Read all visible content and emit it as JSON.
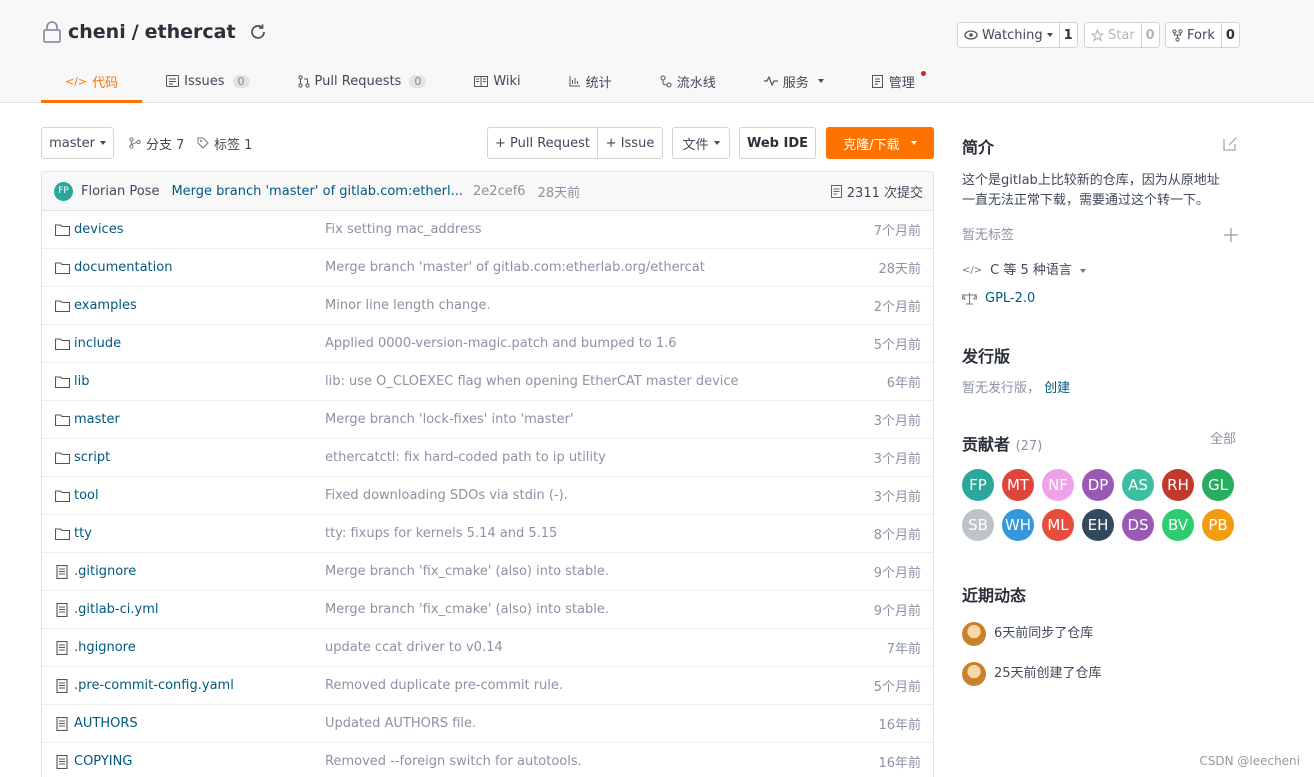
{
  "repo": {
    "owner": "cheni",
    "sep": "/",
    "name": "ethercat"
  },
  "actions": {
    "watch": {
      "label": "Watching",
      "count": "1"
    },
    "star": {
      "label": "Star",
      "count": "0"
    },
    "fork": {
      "label": "Fork",
      "count": "0"
    }
  },
  "tabs": [
    {
      "label": "代码",
      "icon": "code-icon"
    },
    {
      "label": "Issues",
      "badge": "0",
      "icon": "issues-icon"
    },
    {
      "label": "Pull Requests",
      "badge": "0",
      "icon": "pull-request-icon"
    },
    {
      "label": "Wiki",
      "icon": "wiki-icon"
    },
    {
      "label": "统计",
      "icon": "chart-icon"
    },
    {
      "label": "流水线",
      "icon": "pipeline-icon"
    },
    {
      "label": "服务",
      "icon": "pulse-icon"
    },
    {
      "label": "管理",
      "icon": "manage-icon"
    }
  ],
  "toolbar": {
    "branch": "master",
    "branches": "分支 7",
    "tags": "标签 1",
    "pull_request": "+ Pull Request",
    "issue": "+ Issue",
    "file": "文件",
    "web_ide": "Web IDE",
    "clone": "克隆/下载"
  },
  "commit": {
    "avatar": "FP",
    "author": "Florian Pose",
    "message": "Merge branch 'master' of gitlab.com:etherl...",
    "sha": "2e2cef6",
    "time": "28天前",
    "count": "2311 次提交"
  },
  "files": [
    {
      "type": "folder",
      "name": "devices",
      "msg": "Fix setting mac_address",
      "time": "7个月前"
    },
    {
      "type": "folder",
      "name": "documentation",
      "msg": "Merge branch 'master' of gitlab.com:etherlab.org/ethercat",
      "time": "28天前"
    },
    {
      "type": "folder",
      "name": "examples",
      "msg": "Minor line length change.",
      "time": "2个月前"
    },
    {
      "type": "folder",
      "name": "include",
      "msg": "Applied 0000-version-magic.patch and bumped to 1.6",
      "time": "5个月前"
    },
    {
      "type": "folder",
      "name": "lib",
      "msg": "lib: use O_CLOEXEC flag when opening EtherCAT master device",
      "time": "6年前"
    },
    {
      "type": "folder",
      "name": "master",
      "msg": "Merge branch 'lock-fixes' into 'master'",
      "time": "3个月前"
    },
    {
      "type": "folder",
      "name": "script",
      "msg": "ethercatctl: fix hard-coded path to ip utility",
      "time": "3个月前"
    },
    {
      "type": "folder",
      "name": "tool",
      "msg": "Fixed downloading SDOs via stdin (-).",
      "time": "3个月前"
    },
    {
      "type": "folder",
      "name": "tty",
      "msg": "tty: fixups for kernels 5.14 and 5.15",
      "time": "8个月前"
    },
    {
      "type": "file",
      "name": ".gitignore",
      "msg": "Merge branch 'fix_cmake' (also) into stable.",
      "time": "9个月前"
    },
    {
      "type": "file",
      "name": ".gitlab-ci.yml",
      "msg": "Merge branch 'fix_cmake' (also) into stable.",
      "time": "9个月前"
    },
    {
      "type": "file",
      "name": ".hgignore",
      "msg": "update ccat driver to v0.14",
      "time": "7年前"
    },
    {
      "type": "file",
      "name": ".pre-commit-config.yaml",
      "msg": "Removed duplicate pre-commit rule.",
      "time": "5个月前"
    },
    {
      "type": "file",
      "name": "AUTHORS",
      "msg": "Updated AUTHORS file.",
      "time": "16年前"
    },
    {
      "type": "file",
      "name": "COPYING",
      "msg": "Removed --foreign switch for autotools.",
      "time": "16年前"
    }
  ],
  "sidebar": {
    "intro_title": "简介",
    "intro_line1": "这个是gitlab上比较新的仓库，因为从原地址",
    "intro_line2": "一直无法正常下载，需要通过这个转一下。",
    "no_tags": "暂无标签",
    "language": "C 等 5 种语言",
    "license": "GPL-2.0",
    "release_title": "发行版",
    "no_release": "暂无发行版，",
    "create": "创建",
    "contributors_title": "贡献者",
    "contributors_count": "(27)",
    "all": "全部",
    "contributors": [
      {
        "initials": "FP",
        "color": "#2aa69a"
      },
      {
        "initials": "MT",
        "color": "#e0453b"
      },
      {
        "initials": "NF",
        "color": "#eea3e8"
      },
      {
        "initials": "DP",
        "color": "#9b59b6"
      },
      {
        "initials": "AS",
        "color": "#3ebea0"
      },
      {
        "initials": "RH",
        "color": "#c0392b"
      },
      {
        "initials": "GL",
        "color": "#27ae60"
      },
      {
        "initials": "SB",
        "color": "#bdc3c7"
      },
      {
        "initials": "WH",
        "color": "#3498db"
      },
      {
        "initials": "ML",
        "color": "#e74c3c"
      },
      {
        "initials": "EH",
        "color": "#34495e"
      },
      {
        "initials": "DS",
        "color": "#9b59b6"
      },
      {
        "initials": "BV",
        "color": "#2ecc71"
      },
      {
        "initials": "PB",
        "color": "#f39c12"
      }
    ],
    "activity_title": "近期动态",
    "activity1": "6天前同步了仓库",
    "activity2": "25天前创建了仓库"
  },
  "watermark": "CSDN @leecheni"
}
